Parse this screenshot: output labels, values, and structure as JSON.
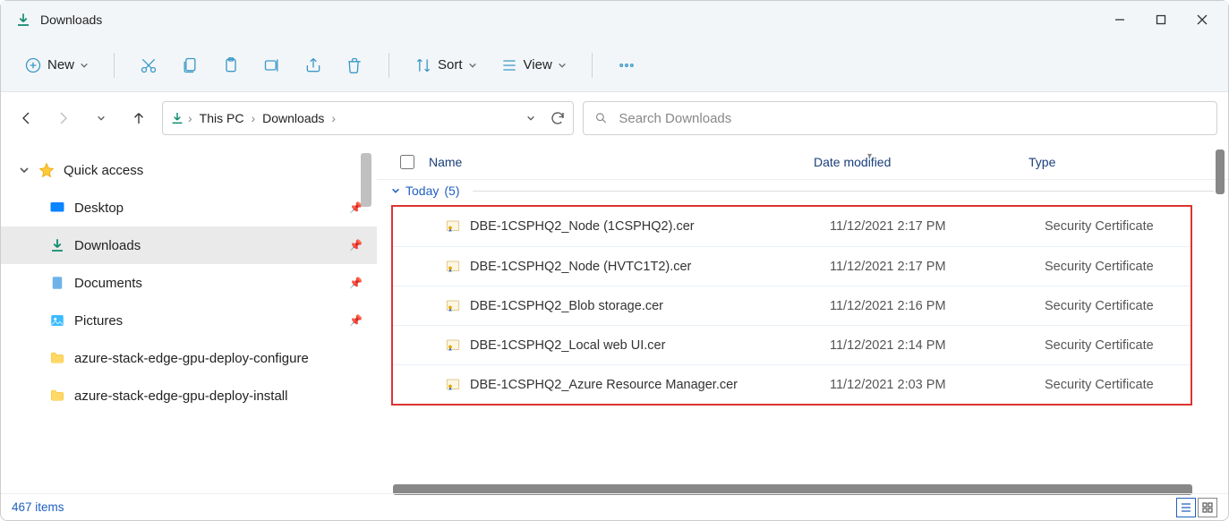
{
  "title": "Downloads",
  "toolbar": {
    "new_label": "New",
    "sort_label": "Sort",
    "view_label": "View"
  },
  "breadcrumbs": [
    "This PC",
    "Downloads"
  ],
  "search": {
    "placeholder": "Search Downloads"
  },
  "sidebar": {
    "quick_access": "Quick access",
    "items": [
      {
        "label": "Desktop",
        "icon": "desktop",
        "pinned": true
      },
      {
        "label": "Downloads",
        "icon": "downloads",
        "pinned": true,
        "selected": true
      },
      {
        "label": "Documents",
        "icon": "documents",
        "pinned": true
      },
      {
        "label": "Pictures",
        "icon": "pictures",
        "pinned": true
      },
      {
        "label": "azure-stack-edge-gpu-deploy-configure",
        "icon": "folder",
        "pinned": false
      },
      {
        "label": "azure-stack-edge-gpu-deploy-install",
        "icon": "folder",
        "pinned": false
      }
    ]
  },
  "columns": {
    "name": "Name",
    "date": "Date modified",
    "type": "Type"
  },
  "group": {
    "label": "Today",
    "count": "5"
  },
  "files": [
    {
      "name": "DBE-1CSPHQ2_Node (1CSPHQ2).cer",
      "date": "11/12/2021 2:17 PM",
      "type": "Security Certificate"
    },
    {
      "name": "DBE-1CSPHQ2_Node (HVTC1T2).cer",
      "date": "11/12/2021 2:17 PM",
      "type": "Security Certificate"
    },
    {
      "name": "DBE-1CSPHQ2_Blob storage.cer",
      "date": "11/12/2021 2:16 PM",
      "type": "Security Certificate"
    },
    {
      "name": "DBE-1CSPHQ2_Local web UI.cer",
      "date": "11/12/2021 2:14 PM",
      "type": "Security Certificate"
    },
    {
      "name": "DBE-1CSPHQ2_Azure Resource Manager.cer",
      "date": "11/12/2021 2:03 PM",
      "type": "Security Certificate"
    }
  ],
  "status": {
    "item_count": "467 items"
  }
}
